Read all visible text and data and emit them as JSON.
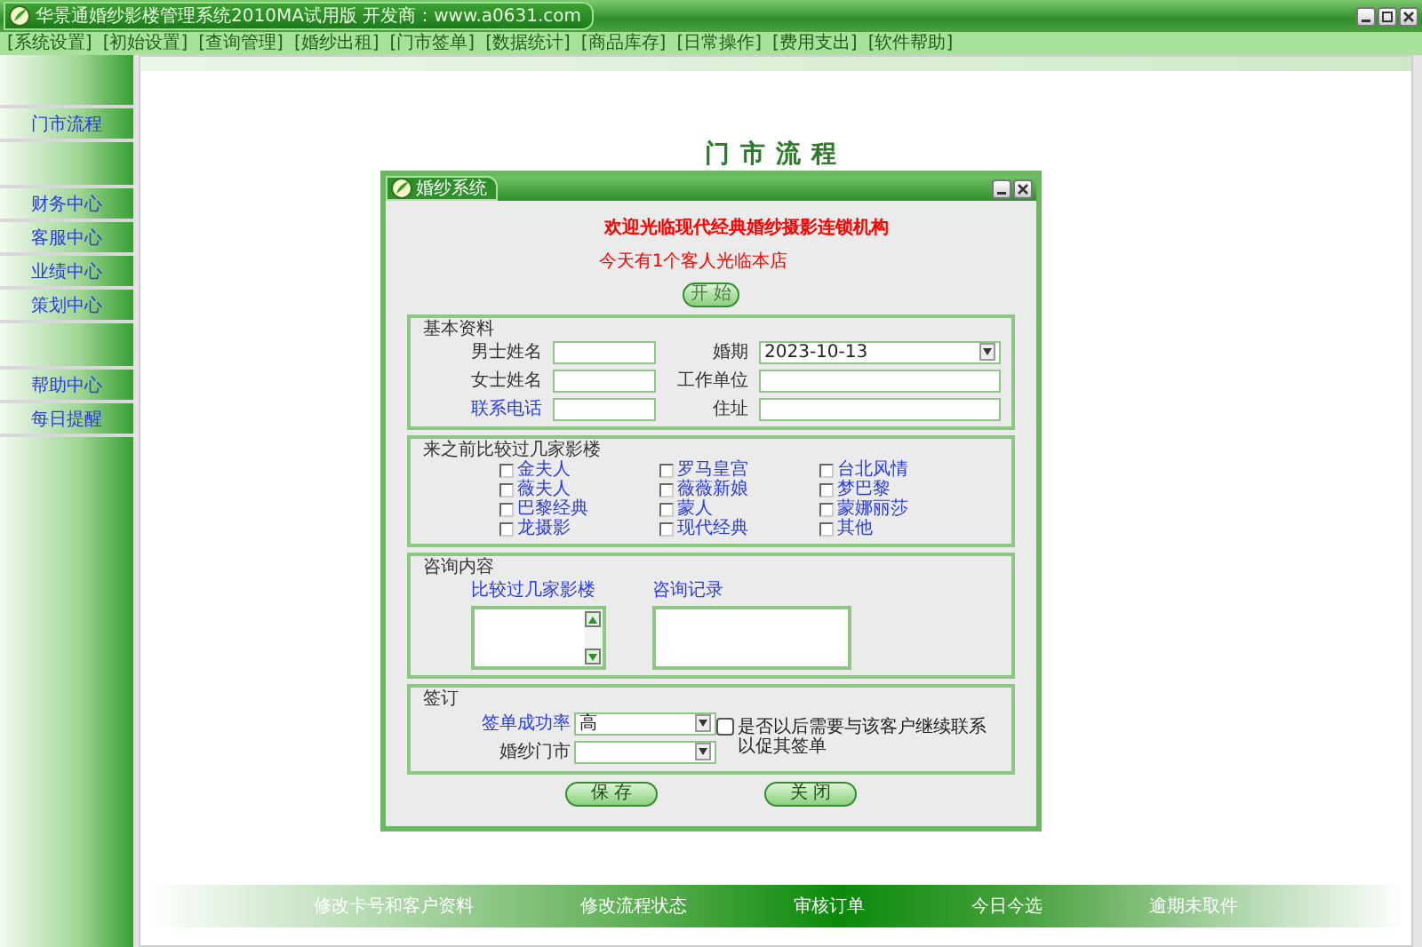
{
  "window": {
    "title": "华景通婚纱影楼管理系统2010MA试用版    开发商：www.a0631.com"
  },
  "menu": [
    "[系统设置]",
    "[初始设置]",
    "[查询管理]",
    "[婚纱出租]",
    "[门市签单]",
    "[数据统计]",
    "[商品库存]",
    "[日常操作]",
    "[费用支出]",
    "[软件帮助]"
  ],
  "sidebar": {
    "groups": [
      [
        "门市流程"
      ],
      [
        "财务中心",
        "客服中心",
        "业绩中心",
        "策划中心"
      ],
      [
        "帮助中心",
        "每日提醒"
      ]
    ]
  },
  "page_heading": "门市流程",
  "dialog": {
    "title": "婚纱系统",
    "welcome": "欢迎光临现代经典婚纱摄影连锁机构",
    "visitors_note": "今天有1个客人光临本店",
    "start_button": {
      "label": "开 始",
      "disabled": true
    },
    "basic_info": {
      "legend": "基本资料",
      "fields": [
        {
          "label": "男士姓名",
          "kind": "text",
          "emphasis": false
        },
        {
          "label": "婚期",
          "kind": "select",
          "value": "2023-10-13",
          "emphasis": false
        },
        {
          "label": "女士姓名",
          "kind": "text",
          "emphasis": false
        },
        {
          "label": "工作单位",
          "kind": "text",
          "emphasis": false
        },
        {
          "label": "联系电话",
          "kind": "text",
          "emphasis": true
        },
        {
          "label": "住址",
          "kind": "text",
          "emphasis": false
        }
      ]
    },
    "compared_studios": {
      "legend": "来之前比较过几家影楼",
      "options": [
        {
          "label": "金夫人",
          "checked": false
        },
        {
          "label": "薇夫人",
          "checked": false
        },
        {
          "label": "巴黎经典",
          "checked": false
        },
        {
          "label": "龙摄影",
          "checked": false
        },
        {
          "label": "罗马皇宫",
          "checked": false
        },
        {
          "label": "薇薇新娘",
          "checked": false
        },
        {
          "label": "蒙人",
          "checked": false
        },
        {
          "label": "现代经典",
          "checked": false
        },
        {
          "label": "台北风情",
          "checked": false
        },
        {
          "label": "梦巴黎",
          "checked": false
        },
        {
          "label": "蒙娜丽莎",
          "checked": false
        },
        {
          "label": "其他",
          "checked": false
        }
      ]
    },
    "consultation": {
      "legend": "咨询内容",
      "compared_label": "比较过几家影楼",
      "record_label": "咨询记录"
    },
    "signing": {
      "legend": "签订",
      "fields": [
        {
          "label": "签单成功率",
          "value": "高",
          "emphasis": true
        },
        {
          "label": "婚纱门市",
          "emphasis": false
        }
      ],
      "follow_up": {
        "label": "是否以后需要与该客户继续联系以促其签单",
        "checked": false
      }
    },
    "buttons": [
      "保 存",
      "关 闭"
    ]
  },
  "bottom_bar": [
    "修改卡号和客户资料",
    "修改流程状态",
    "审核订单",
    "今日今选",
    "逾期未取件"
  ]
}
